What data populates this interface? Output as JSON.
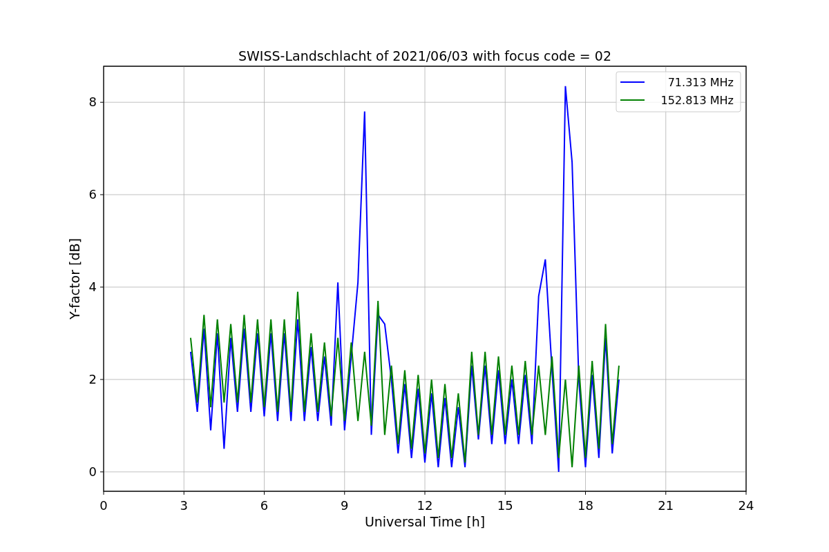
{
  "figure": {
    "chart_data": {
      "type": "line",
      "title": "SWISS-Landschlacht of 2021/06/03 with focus code = 02",
      "xlabel": "Universal Time [h]",
      "ylabel": "Y-factor [dB]",
      "x": [
        3.25,
        3.5,
        3.75,
        4.0,
        4.25,
        4.5,
        4.75,
        5.0,
        5.25,
        5.5,
        5.75,
        6.0,
        6.25,
        6.5,
        6.75,
        7.0,
        7.25,
        7.5,
        7.75,
        8.0,
        8.25,
        8.5,
        8.75,
        9.0,
        9.25,
        9.5,
        9.75,
        10.0,
        10.25,
        10.5,
        10.75,
        11.0,
        11.25,
        11.5,
        11.75,
        12.0,
        12.25,
        12.5,
        12.75,
        13.0,
        13.25,
        13.5,
        13.75,
        14.0,
        14.25,
        14.5,
        14.75,
        15.0,
        15.25,
        15.5,
        15.75,
        16.0,
        16.25,
        16.5,
        16.75,
        17.0,
        17.25,
        17.5,
        17.75,
        18.0,
        18.25,
        18.5,
        18.75,
        19.0,
        19.25
      ],
      "series": [
        {
          "name": "71.313 MHz",
          "color": "#0000ff",
          "values": [
            2.6,
            1.3,
            3.1,
            0.9,
            3.0,
            0.5,
            2.9,
            1.3,
            3.1,
            1.3,
            3.0,
            1.2,
            3.0,
            1.1,
            3.0,
            1.1,
            3.3,
            1.1,
            2.7,
            1.1,
            2.5,
            1.0,
            4.1,
            0.9,
            2.5,
            4.1,
            7.8,
            0.8,
            3.4,
            3.2,
            2.0,
            0.4,
            1.9,
            0.3,
            1.8,
            0.2,
            1.7,
            0.1,
            1.6,
            0.1,
            1.4,
            0.1,
            2.3,
            0.7,
            2.3,
            0.6,
            2.2,
            0.6,
            2.0,
            0.6,
            2.1,
            0.6,
            3.8,
            4.6,
            2.2,
            0.0,
            8.35,
            6.7,
            2.0,
            0.1,
            2.1,
            0.3,
            2.9,
            0.4,
            2.0
          ]
        },
        {
          "name": "152.813 MHz",
          "color": "#008000",
          "values": [
            2.9,
            1.5,
            3.4,
            1.4,
            3.3,
            1.5,
            3.2,
            1.5,
            3.4,
            1.5,
            3.3,
            1.4,
            3.3,
            1.3,
            3.3,
            1.3,
            3.9,
            1.3,
            3.0,
            1.3,
            2.8,
            1.2,
            2.9,
            1.1,
            2.8,
            1.1,
            2.6,
            1.0,
            3.7,
            0.8,
            2.3,
            0.6,
            2.2,
            0.5,
            2.1,
            0.4,
            2.0,
            0.3,
            1.9,
            0.3,
            1.7,
            0.2,
            2.6,
            0.8,
            2.6,
            0.8,
            2.5,
            0.8,
            2.3,
            0.8,
            2.4,
            0.8,
            2.3,
            0.8,
            2.5,
            0.3,
            2.0,
            0.1,
            2.3,
            0.3,
            2.4,
            0.5,
            3.2,
            0.6,
            2.3
          ]
        }
      ],
      "grid": true,
      "legend": true,
      "xlim": [
        0,
        24
      ],
      "ylim": [
        -0.42,
        8.78
      ],
      "xticks": [
        0,
        3,
        6,
        9,
        12,
        15,
        18,
        21,
        24
      ],
      "yticks": [
        0,
        2,
        4,
        6,
        8
      ]
    }
  }
}
